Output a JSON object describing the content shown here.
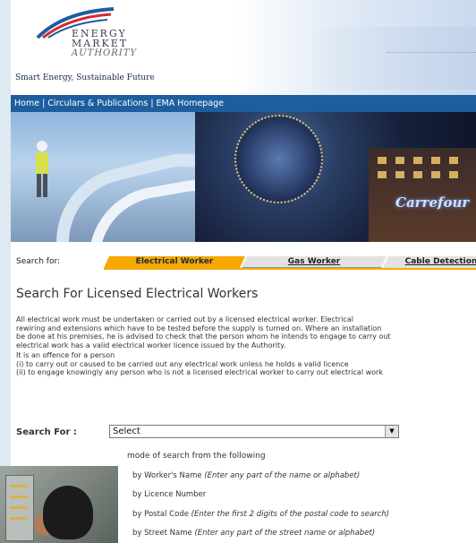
{
  "logo": {
    "line1": "ENERGY",
    "line2": "MARKET",
    "line3": "AUTHORITY",
    "tagline": "Smart Energy, Sustainable Future"
  },
  "nav": {
    "items": [
      {
        "label": "Home"
      },
      {
        "label": "Circulars & Publications"
      },
      {
        "label": "EMA Homepage"
      }
    ],
    "separator": "|"
  },
  "banner": {
    "sign_text": "Carrefour"
  },
  "search_for": {
    "label": "Search for:",
    "tabs": [
      {
        "label": "Electrical Worker",
        "active": true
      },
      {
        "label": "Gas Worker",
        "active": false
      },
      {
        "label": "Cable Detection",
        "active": false
      }
    ]
  },
  "page_title": "Search For Licensed Electrical Workers",
  "intro": {
    "lines": [
      "All electrical work must be undertaken or carried out by a licensed electrical worker. Electrical",
      "rewiring and extensions which have to be tested before the supply is turned on. Where an installation",
      "be done at his premises, he is advised to check that the person whom he intends to engage to carry out",
      "electrical work has a valid electrical worker licence issued by the Authority."
    ]
  },
  "offence": {
    "lines": [
      "It is an offence for a person",
      "(i) to carry out or caused to be carried out any electrical work unless he holds a valid licence",
      "(ii) to engage knowingly any person who is not a licensed electrical worker to carry out electrical work"
    ]
  },
  "search_form": {
    "label": "Search For :",
    "selected": "Select"
  },
  "mode": {
    "intro": "mode of search from the following",
    "options": [
      {
        "label": "by Worker's Name",
        "hint": "(Enter any part of the name or alphabet)"
      },
      {
        "label": "by Licence Number",
        "hint": ""
      },
      {
        "label": "by Postal Code",
        "hint": "(Enter the first 2 digits of the postal code to search)"
      },
      {
        "label": "by Street Name",
        "hint": "(Enter any part of the street name or alphabet)"
      }
    ]
  },
  "colors": {
    "nav_bg": "#1d5e9e",
    "tab_active": "#f5a800",
    "tab_inactive": "#e2e2e2"
  }
}
